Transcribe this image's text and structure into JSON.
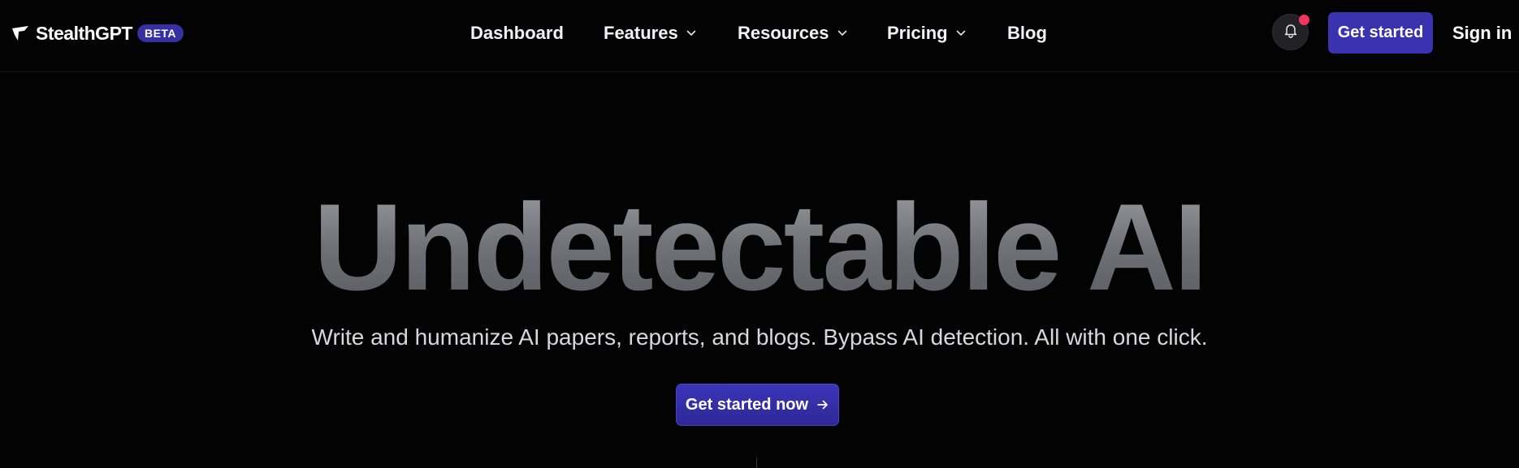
{
  "brand": {
    "name": "StealthGPT",
    "badge": "BETA"
  },
  "nav": {
    "items": [
      {
        "label": "Dashboard",
        "has_dropdown": false
      },
      {
        "label": "Features",
        "has_dropdown": true
      },
      {
        "label": "Resources",
        "has_dropdown": true
      },
      {
        "label": "Pricing",
        "has_dropdown": true
      },
      {
        "label": "Blog",
        "has_dropdown": false
      }
    ]
  },
  "header_actions": {
    "notifications_icon": "bell-icon",
    "has_unread": true,
    "get_started_label": "Get started",
    "sign_in_label": "Sign in"
  },
  "hero": {
    "title": "Undetectable AI",
    "subtitle": "Write and humanize AI papers, reports, and blogs. Bypass AI detection. All with one click.",
    "cta_label": "Get started now",
    "cta_icon": "arrow-right-icon"
  },
  "colors": {
    "background": "#030303",
    "accent": "#3a33b0",
    "notification_dot": "#f0355e"
  }
}
